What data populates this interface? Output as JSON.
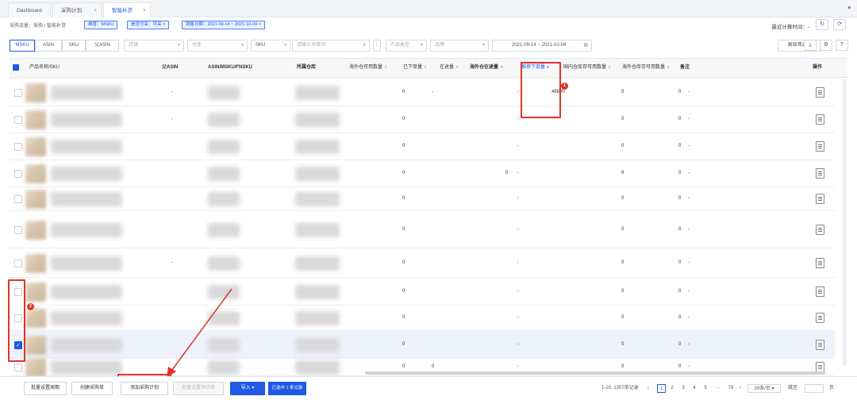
{
  "tabs": [
    {
      "label": "Dashboard"
    },
    {
      "label": "采购计划"
    },
    {
      "label": "智能补货"
    }
  ],
  "breadcrumb": "采购流量：采购  /  智能补货",
  "filter_tags": [
    {
      "label": "维度：MSKU"
    },
    {
      "label": "是否可采：可采"
    },
    {
      "label": "销售日期：2021-09-14 ~ 2021-10-04"
    }
  ],
  "last_calc": "最近计算时间：-",
  "dimension_tabs": [
    {
      "label": "MSKU"
    },
    {
      "label": "ASIN"
    },
    {
      "label": "SKU"
    },
    {
      "label": "父ASIN"
    }
  ],
  "filters": {
    "shop": "店铺",
    "warehouse": "仓库",
    "search_type": "SKU",
    "search_placeholder": "请输入关键词",
    "product_type": "产品类型",
    "status": "品牌",
    "date_from": "2021-09-14",
    "date_sep": "~",
    "date_to": "2021-10-04",
    "advanced": "高级筛选"
  },
  "columns": {
    "product": "产品名称/SKU",
    "parent_asin": "父ASIN",
    "asin": "ASIN/MSKU/FNSKU",
    "warehouse": "所属仓库",
    "fba_qty": "海外仓可用数量",
    "pending": "已下单量",
    "in_transit": "在途量",
    "overseas": "海外仓在途量",
    "suggest": "推荐下单量",
    "domestic": "国内仓库存可用数量",
    "overseas_stock": "海外仓库存可用数量",
    "remark": "备注",
    "action": "操作"
  },
  "rows": [
    {
      "parent": "-",
      "fba": "0",
      "pending": "-",
      "in_transit": "",
      "overseas": "-",
      "suggest": "48800",
      "domestic": "0",
      "overseas_stock": "0",
      "remark": "-",
      "checked": false
    },
    {
      "parent": "-",
      "fba": "0",
      "pending": "",
      "in_transit": "",
      "overseas": "-",
      "suggest": "",
      "domestic": "0",
      "overseas_stock": "0",
      "remark": "-",
      "checked": false
    },
    {
      "parent": "",
      "fba": "0",
      "pending": "",
      "in_transit": "",
      "overseas": "-",
      "suggest": "",
      "domestic": "0",
      "overseas_stock": "0",
      "remark": "-",
      "checked": false
    },
    {
      "parent": "",
      "fba": "0",
      "pending": "",
      "in_transit": "0",
      "overseas": "-",
      "suggest": "",
      "domestic": "9",
      "overseas_stock": "0",
      "remark": "-",
      "checked": false
    },
    {
      "parent": "",
      "fba": "0",
      "pending": "",
      "in_transit": "",
      "overseas": "-",
      "suggest": "",
      "domestic": "0",
      "overseas_stock": "0",
      "remark": "-",
      "checked": false
    },
    {
      "parent": "",
      "fba": "0",
      "pending": "",
      "in_transit": "",
      "overseas": "-",
      "suggest": "",
      "domestic": "0",
      "overseas_stock": "0",
      "remark": "-",
      "checked": false
    },
    {
      "parent": "-",
      "fba": "0",
      "pending": "",
      "in_transit": "",
      "overseas": "-",
      "suggest": "",
      "domestic": "0",
      "overseas_stock": "0",
      "remark": "-",
      "checked": false
    },
    {
      "parent": "",
      "fba": "0",
      "pending": "",
      "in_transit": "",
      "overseas": "-",
      "suggest": "",
      "domestic": "0",
      "overseas_stock": "0",
      "remark": "-",
      "checked": false
    },
    {
      "parent": "",
      "fba": "0",
      "pending": "",
      "in_transit": "",
      "overseas": "-",
      "suggest": "",
      "domestic": "0",
      "overseas_stock": "0",
      "remark": "-",
      "checked": false
    },
    {
      "parent": "",
      "fba": "0",
      "pending": "",
      "in_transit": "",
      "overseas": "-",
      "suggest": "",
      "domestic": "0",
      "overseas_stock": "0",
      "remark": "-",
      "checked": true
    },
    {
      "parent": "",
      "fba": "0",
      "pending": "0",
      "in_transit": "",
      "overseas": "-",
      "suggest": "",
      "domestic": "0",
      "overseas_stock": "0",
      "remark": "-",
      "checked": false
    }
  ],
  "annotations": {
    "badge1": "1",
    "badge2": "2"
  },
  "bottom": {
    "batch_set": "批量设置周期",
    "create_order": "创建采购单",
    "add_plan": "添加采购计划",
    "batch_disabled": "批量设置供应商",
    "import": "导入",
    "selected": "已选中 1 条记录",
    "summary": "1-20, 1357条记录",
    "pages": [
      "1",
      "2",
      "3",
      "4",
      "5",
      "···",
      "79"
    ],
    "page_size": "20条/页",
    "goto": "跳至",
    "goto_suffix": "页"
  },
  "colors": {
    "accent": "#1f59e4",
    "annotation": "#e0342a"
  }
}
